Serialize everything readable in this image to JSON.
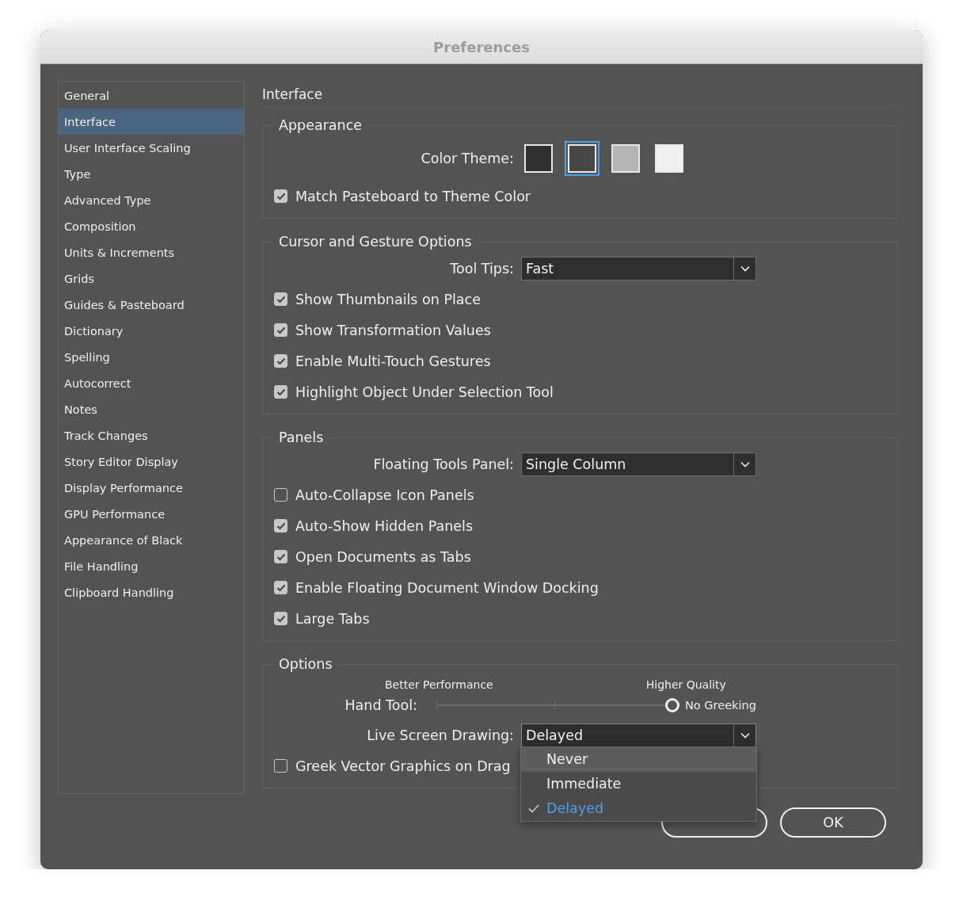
{
  "window": {
    "title": "Preferences"
  },
  "sidebar": {
    "items": [
      {
        "label": "General",
        "selected": false
      },
      {
        "label": "Interface",
        "selected": true
      },
      {
        "label": "User Interface Scaling",
        "selected": false
      },
      {
        "label": "Type",
        "selected": false
      },
      {
        "label": "Advanced Type",
        "selected": false
      },
      {
        "label": "Composition",
        "selected": false
      },
      {
        "label": "Units & Increments",
        "selected": false
      },
      {
        "label": "Grids",
        "selected": false
      },
      {
        "label": "Guides & Pasteboard",
        "selected": false
      },
      {
        "label": "Dictionary",
        "selected": false
      },
      {
        "label": "Spelling",
        "selected": false
      },
      {
        "label": "Autocorrect",
        "selected": false
      },
      {
        "label": "Notes",
        "selected": false
      },
      {
        "label": "Track Changes",
        "selected": false
      },
      {
        "label": "Story Editor Display",
        "selected": false
      },
      {
        "label": "Display Performance",
        "selected": false
      },
      {
        "label": "GPU Performance",
        "selected": false
      },
      {
        "label": "Appearance of Black",
        "selected": false
      },
      {
        "label": "File Handling",
        "selected": false
      },
      {
        "label": "Clipboard Handling",
        "selected": false
      }
    ]
  },
  "page_title": "Interface",
  "sections": [
    {
      "title": "Appearance",
      "rows": [
        {
          "kind": "swatches",
          "label": "Color Theme:",
          "swatches": [
            {
              "color": "#2e2e2e",
              "selected": false
            },
            {
              "color": "#474747",
              "selected": true
            },
            {
              "color": "#b5b5b5",
              "selected": false
            },
            {
              "color": "#f0f0f0",
              "selected": false
            }
          ]
        },
        {
          "kind": "checkbox",
          "label": "Match Pasteboard to Theme Color",
          "checked": true
        }
      ]
    },
    {
      "title": "Cursor and Gesture Options",
      "rows": [
        {
          "kind": "select",
          "label": "Tool Tips:",
          "value": "Fast"
        },
        {
          "kind": "checkbox",
          "label": "Show Thumbnails on Place",
          "checked": true
        },
        {
          "kind": "checkbox",
          "label": "Show Transformation Values",
          "checked": true
        },
        {
          "kind": "checkbox",
          "label": "Enable Multi-Touch Gestures",
          "checked": true
        },
        {
          "kind": "checkbox",
          "label": "Highlight Object Under Selection Tool",
          "checked": true
        }
      ]
    },
    {
      "title": "Panels",
      "rows": [
        {
          "kind": "select",
          "label": "Floating Tools Panel:",
          "value": "Single Column"
        },
        {
          "kind": "checkbox",
          "label": "Auto-Collapse Icon Panels",
          "checked": false
        },
        {
          "kind": "checkbox",
          "label": "Auto-Show Hidden Panels",
          "checked": true
        },
        {
          "kind": "checkbox",
          "label": "Open Documents as Tabs",
          "checked": true
        },
        {
          "kind": "checkbox",
          "label": "Enable Floating Document Window Docking",
          "checked": true
        },
        {
          "kind": "checkbox",
          "label": "Large Tabs",
          "checked": true
        }
      ]
    },
    {
      "title": "Options",
      "rows": [
        {
          "kind": "slider",
          "label": "Hand Tool:",
          "left_caption": "Better Performance",
          "right_caption": "Higher Quality",
          "level": 1,
          "reading": "No Greeking"
        },
        {
          "kind": "select",
          "label": "Live Screen Drawing:",
          "value": "Delayed",
          "expanded": true,
          "options": [
            {
              "label": "Never",
              "selected": false,
              "hovered": true
            },
            {
              "label": "Immediate",
              "selected": false,
              "hovered": false
            },
            {
              "label": "Delayed",
              "selected": true,
              "hovered": false
            }
          ]
        },
        {
          "kind": "checkbox",
          "label": "Greek Vector Graphics on Drag",
          "checked": false
        }
      ]
    }
  ],
  "buttons": [
    {
      "kind": "covered"
    },
    {
      "kind": "labeled",
      "label": "OK"
    }
  ]
}
